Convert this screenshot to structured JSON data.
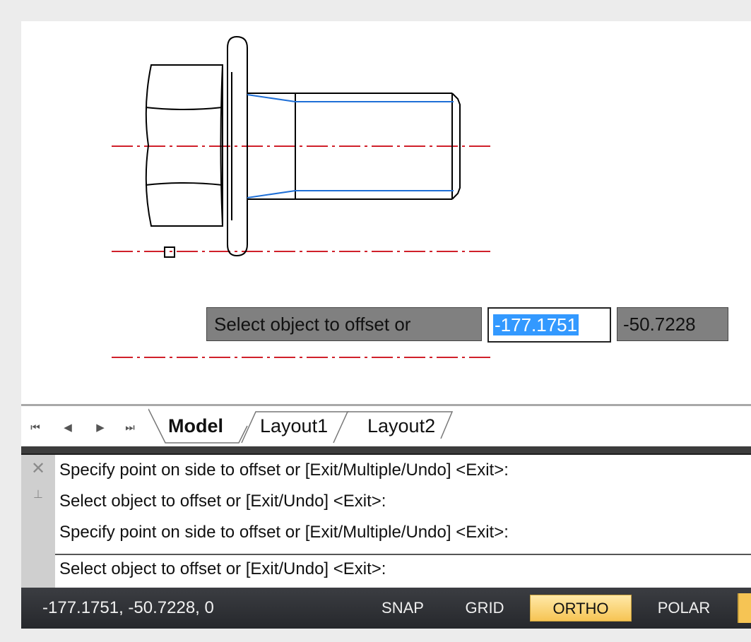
{
  "dynamic_input": {
    "prompt": "Select object to offset or",
    "x_value": "-177.1751",
    "y_value": "-50.7228"
  },
  "tabs": {
    "nav_first": "⏮",
    "nav_prev": "◀",
    "nav_next": "▶",
    "nav_last": "⏭",
    "model": "Model",
    "layout1": "Layout1",
    "layout2": "Layout2"
  },
  "command": {
    "history": [
      "Specify point on side to offset or [Exit/Multiple/Undo] <Exit>:",
      "Select object to offset or [Exit/Undo] <Exit>:",
      "Specify point on side to offset or [Exit/Multiple/Undo] <Exit>:"
    ],
    "current": "Select object to offset or [Exit/Undo] <Exit>:",
    "close_icon": "✕",
    "pin_icon": "⊥"
  },
  "status": {
    "coordinates": "-177.1751, -50.7228, 0",
    "snap": "SNAP",
    "grid": "GRID",
    "ortho": "ORTHO",
    "polar": "POLAR"
  },
  "colors": {
    "centerline": "#d0202a",
    "thread": "#1f6fd6",
    "highlight": "#3399ff",
    "ortho_on": "#f6c454"
  }
}
